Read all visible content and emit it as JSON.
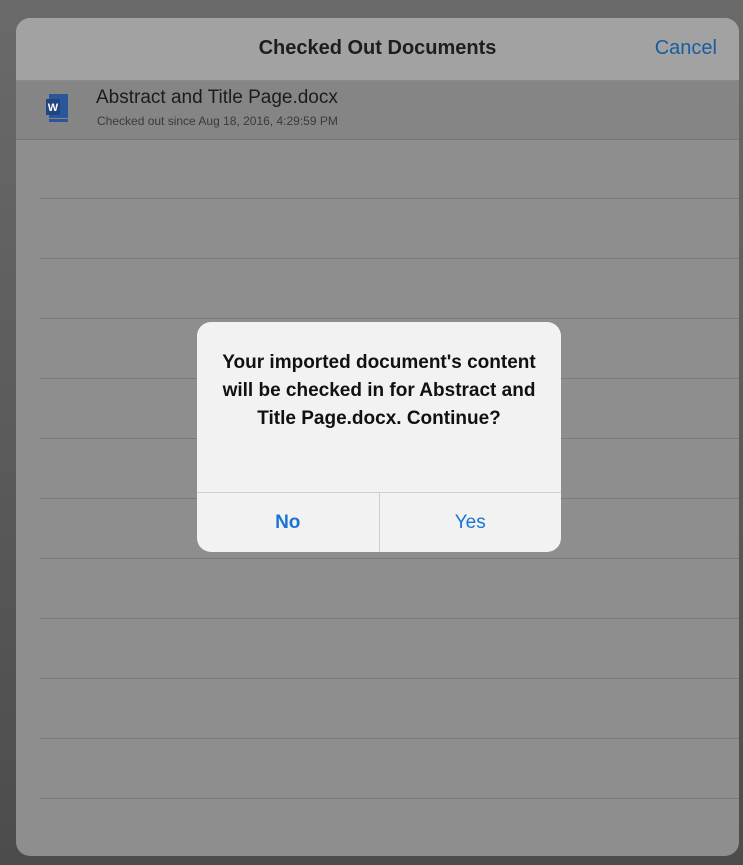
{
  "navbar": {
    "title": "Checked Out Documents",
    "cancel_label": "Cancel"
  },
  "document": {
    "icon": "word-document-icon",
    "name": "Abstract and Title Page.docx",
    "subtitle": "Checked out since Aug 18, 2016, 4:29:59 PM"
  },
  "alert": {
    "message": "Your imported document's content will be checked in for Abstract and Title Page.docx. Continue?",
    "no_label": "No",
    "yes_label": "Yes"
  },
  "colors": {
    "accent": "#1a74d8",
    "word_blue": "#2b579a"
  }
}
